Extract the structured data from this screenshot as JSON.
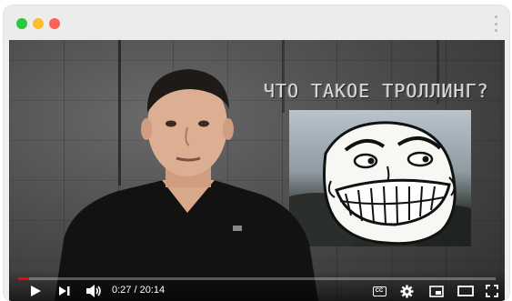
{
  "browser": {
    "traffic_lights": {
      "green": "#28c840",
      "yellow": "#febc2e",
      "red": "#ff5f57"
    }
  },
  "video": {
    "overlay_title": "ЧТО ТАКОЕ ТРОЛЛИНГ?",
    "progress": 0.022,
    "time": "0:27 / 20:14",
    "accent_color": "#ff0000"
  },
  "controls": {
    "cc_label": "CC",
    "icons": [
      "play-icon",
      "next-icon",
      "volume-icon",
      "subtitles-icon",
      "settings-icon",
      "miniplayer-icon",
      "theater-mode-icon",
      "fullscreen-icon"
    ]
  }
}
